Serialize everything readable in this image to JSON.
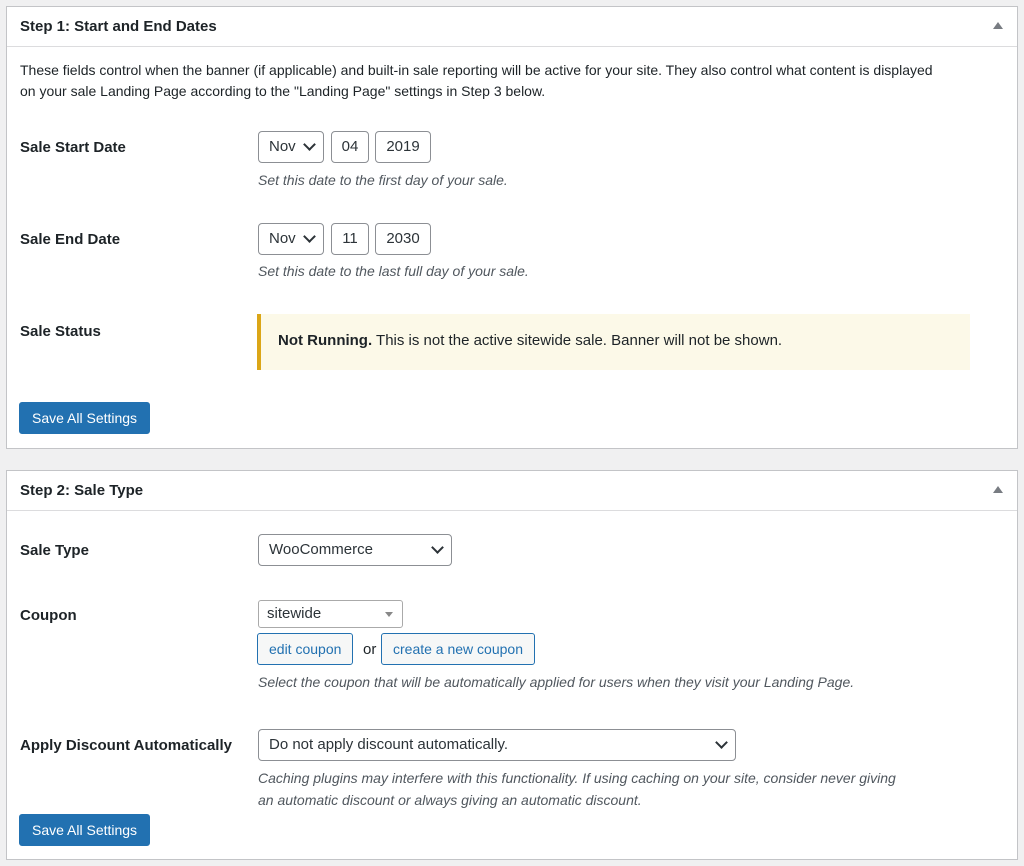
{
  "step1": {
    "title": "Step 1: Start and End Dates",
    "description_line1": "These fields control when the banner (if applicable) and built-in sale reporting will be active for your site. They also control what content is displayed",
    "description_line2": "on your sale Landing Page according to the \"Landing Page\" settings in Step 3 below.",
    "start": {
      "label": "Sale Start Date",
      "month": "Nov",
      "day": "04",
      "year": "2019",
      "hint": "Set this date to the first day of your sale."
    },
    "end": {
      "label": "Sale End Date",
      "month": "Nov",
      "day": "11",
      "year": "2030",
      "hint": "Set this date to the last full day of your sale."
    },
    "status": {
      "label": "Sale Status",
      "notice_strong": "Not Running.",
      "notice_text": " This is not the active sitewide sale. Banner will not be shown."
    },
    "save_label": "Save All Settings"
  },
  "step2": {
    "title": "Step 2: Sale Type",
    "sale_type": {
      "label": "Sale Type",
      "value": "WooCommerce"
    },
    "coupon": {
      "label": "Coupon",
      "value": "sitewide",
      "edit_label": "edit coupon",
      "or_text": "or",
      "create_label": "create a new coupon",
      "hint": "Select the coupon that will be automatically applied for users when they visit your Landing Page."
    },
    "apply_discount": {
      "label": "Apply Discount Automatically",
      "value": "Do not apply discount automatically.",
      "hint_line1": "Caching plugins may interfere with this functionality. If using caching on your site, consider never giving",
      "hint_line2": "an automatic discount or always giving an automatic discount."
    },
    "save_label": "Save All Settings"
  },
  "colors": {
    "primary": "#2271b1",
    "notice_border": "#dba617",
    "notice_bg": "#fcf9e8"
  }
}
